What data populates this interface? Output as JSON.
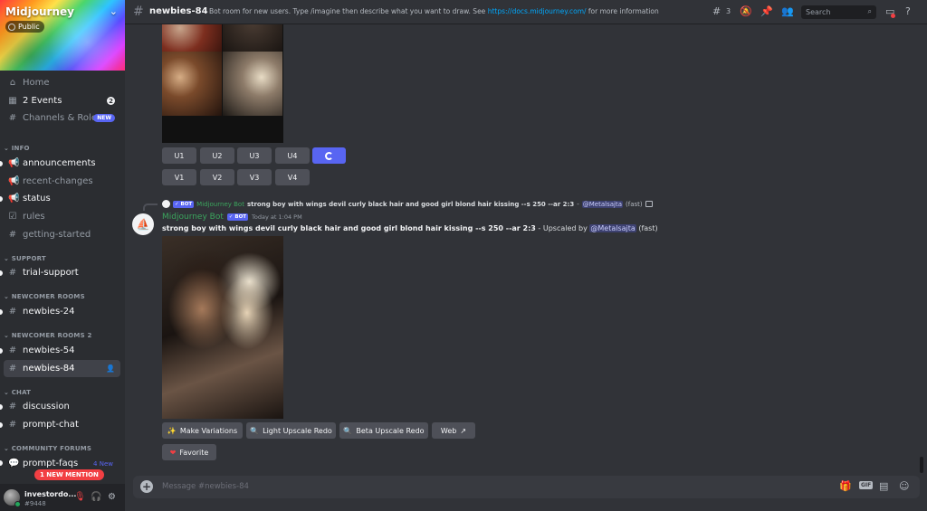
{
  "server": {
    "name": "Midjourney",
    "visibility": "Public"
  },
  "sidebar": {
    "top_items": [
      {
        "label": "Home",
        "icon": "home-icon"
      },
      {
        "label": "2 Events",
        "icon": "calendar-icon",
        "badge": "2"
      },
      {
        "label": "Channels & Roles",
        "icon": "channels-roles-icon",
        "badge": "NEW"
      }
    ],
    "categories": [
      {
        "name": "INFO",
        "channels": [
          "announcements",
          "recent-changes",
          "status",
          "rules",
          "getting-started"
        ]
      },
      {
        "name": "SUPPORT",
        "channels": [
          "trial-support"
        ]
      },
      {
        "name": "NEWCOMER ROOMS",
        "channels": [
          "newbies-24"
        ]
      },
      {
        "name": "NEWCOMER ROOMS 2",
        "channels": [
          "newbies-54",
          "newbies-84"
        ]
      },
      {
        "name": "CHAT",
        "channels": [
          "discussion",
          "prompt-chat"
        ]
      },
      {
        "name": "COMMUNITY FORUMS",
        "channels": [
          "prompt-faqs"
        ]
      }
    ],
    "forum_new": "4 New",
    "mention_pill": "1 NEW MENTION"
  },
  "user": {
    "name": "investordo...",
    "tag": "#9448"
  },
  "header": {
    "channel": "newbies-84",
    "topic_pre": "Bot room for new users. Type /imagine then describe what you want to draw. See ",
    "topic_link": "https://docs.midjourney.com/",
    "topic_post": " for more information",
    "thread_count": "3",
    "search_placeholder": "Search"
  },
  "grid_message": {
    "upscale_buttons": [
      "U1",
      "U2",
      "U3",
      "U4"
    ],
    "variation_buttons": [
      "V1",
      "V2",
      "V3",
      "V4"
    ]
  },
  "message": {
    "reply": {
      "bot_tag": "✓ BOT",
      "author": "Midjourney Bot",
      "prompt": "strong boy with wings devil curly black hair and good girl blond hair kissing --s 250 --ar 2:3",
      "sep": " - ",
      "mention": "@Metalsajta",
      "speed": " (fast)"
    },
    "author": "Midjourney Bot",
    "bot_tag": "✓ BOT",
    "time": "Today at 1:04 PM",
    "prompt": "strong boy with wings devil curly black hair and good girl blond hair kissing --s 250 --ar 2:3",
    "upscaled_by": " - Upscaled by ",
    "mention": "@Metalsajta",
    "speed": " (fast)",
    "actions": [
      "Make Variations",
      "Light Upscale Redo",
      "Beta Upscale Redo",
      "Web"
    ],
    "favorite": "Favorite"
  },
  "composer": {
    "placeholder": "Message #newbies-84",
    "gif_label": "GIF"
  }
}
